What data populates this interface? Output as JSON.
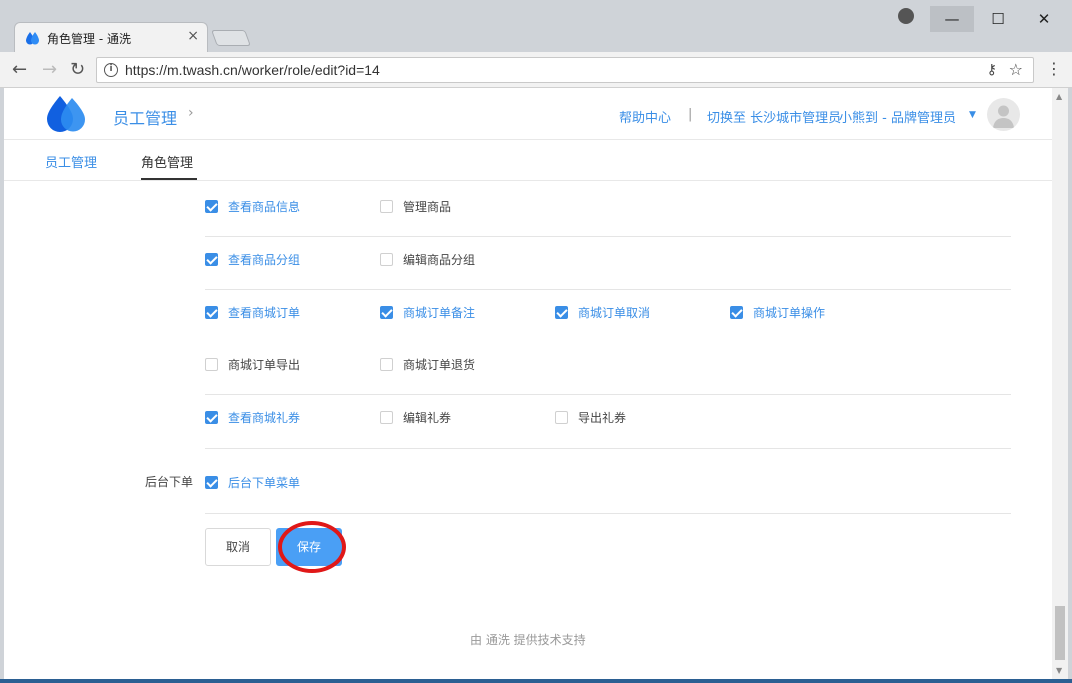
{
  "browser": {
    "tab_title": "角色管理 - 通洗",
    "url": "https://m.twash.cn/worker/role/edit?id=14",
    "win_min": "—",
    "win_max": "☐",
    "win_close": "✕"
  },
  "header": {
    "crumb": "员工管理",
    "help": "帮助中心",
    "sep": "|",
    "switch": "切换至 长沙城市管理员",
    "user": "小熊到 - 品牌管理员"
  },
  "subnav": {
    "staff": "员工管理",
    "role": "角色管理"
  },
  "permissions": {
    "rows": [
      {
        "items": [
          {
            "label": "查看商品信息",
            "checked": true
          },
          {
            "label": "管理商品",
            "checked": false
          }
        ]
      },
      {
        "items": [
          {
            "label": "查看商品分组",
            "checked": true
          },
          {
            "label": "编辑商品分组",
            "checked": false
          }
        ]
      },
      {
        "items": [
          {
            "label": "查看商城订单",
            "checked": true
          },
          {
            "label": "商城订单备注",
            "checked": true
          },
          {
            "label": "商城订单取消",
            "checked": true
          },
          {
            "label": "商城订单操作",
            "checked": true
          }
        ]
      },
      {
        "items": [
          {
            "label": "商城订单导出",
            "checked": false
          },
          {
            "label": "商城订单退货",
            "checked": false
          }
        ]
      },
      {
        "items": [
          {
            "label": "查看商城礼券",
            "checked": true
          },
          {
            "label": "编辑礼券",
            "checked": false
          },
          {
            "label": "导出礼券",
            "checked": false
          }
        ]
      }
    ],
    "backend_section": "后台下单",
    "backend_item": {
      "label": "后台下单菜单",
      "checked": true
    }
  },
  "actions": {
    "cancel": "取消",
    "save": "保存"
  },
  "footer": "由 通洗 提供技术支持",
  "colors": {
    "accent": "#3a8ee6",
    "save_button": "#4a9ff5",
    "highlight": "#e01818"
  }
}
